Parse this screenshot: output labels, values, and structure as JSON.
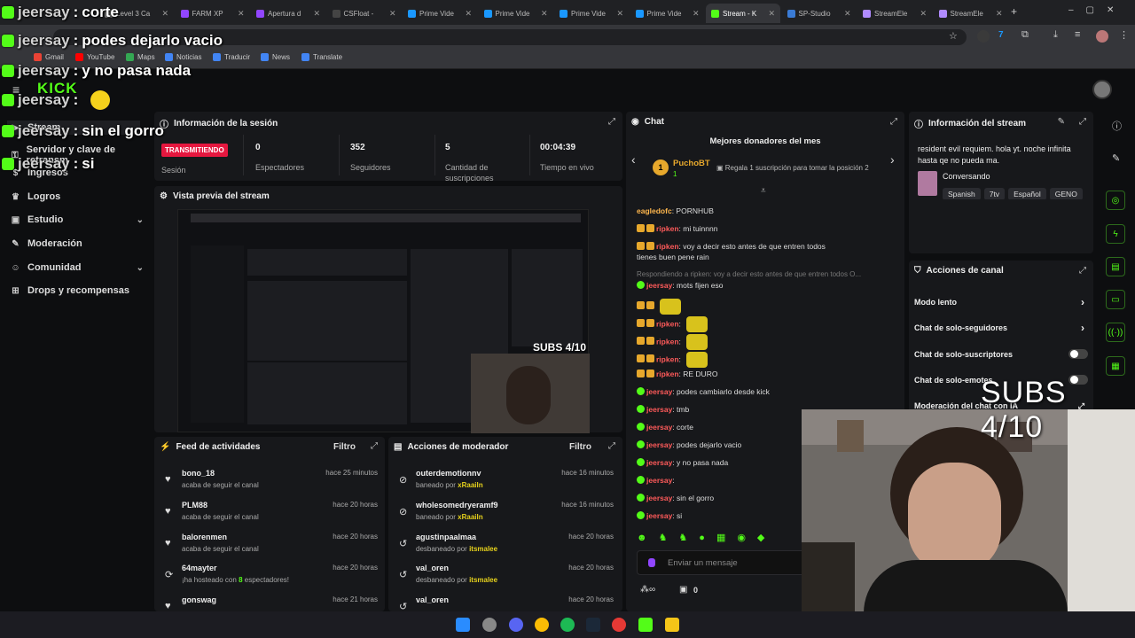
{
  "browser": {
    "tabs": [
      {
        "label": "Level 3 Ca",
        "color": "#7c7c7c"
      },
      {
        "label": "FARM XP",
        "color": "#9146ff"
      },
      {
        "label": "Apertura d",
        "color": "#9146ff"
      },
      {
        "label": "CSFloat -",
        "color": "#444"
      },
      {
        "label": "Prime Vide",
        "color": "#1a98ff"
      },
      {
        "label": "Prime Vide",
        "color": "#1a98ff"
      },
      {
        "label": "Prime Vide",
        "color": "#1a98ff"
      },
      {
        "label": "Prime Vide",
        "color": "#1a98ff"
      },
      {
        "label": "Stream - K",
        "color": "#53fc18"
      },
      {
        "label": "SP-Studio",
        "color": "#3a7bd5"
      },
      {
        "label": "StreamEle",
        "color": "#b08bff"
      },
      {
        "label": "StreamEle",
        "color": "#b08bff"
      }
    ],
    "bookmarks": [
      "Gmail",
      "YouTube",
      "Maps",
      "Noticias",
      "Traducir",
      "News",
      "Translate"
    ]
  },
  "overlay_chat": [
    {
      "user": "jeersay",
      "text": "corte"
    },
    {
      "user": "jeersay",
      "text": "podes dejarlo vacio"
    },
    {
      "user": "jeersay",
      "text": "y no pasa nada"
    },
    {
      "user": "jeersay",
      "text": ""
    },
    {
      "user": "jeersay",
      "text": "sin el gorro"
    },
    {
      "user": "jeersay",
      "text": "si"
    }
  ],
  "sidebar": {
    "logo": "KICK",
    "items": [
      {
        "label": "Stream",
        "icon": "stream-icon",
        "chevron": false
      },
      {
        "label": "Servidor y clave de retransm",
        "icon": "key-icon",
        "chevron": false
      },
      {
        "label": "Ingresos",
        "icon": "money-icon",
        "chevron": false
      },
      {
        "label": "Logros",
        "icon": "trophy-icon",
        "chevron": false
      },
      {
        "label": "Estudio",
        "icon": "studio-icon",
        "chevron": true
      },
      {
        "label": "Moderación",
        "icon": "wrench-icon",
        "chevron": false
      },
      {
        "label": "Comunidad",
        "icon": "community-icon",
        "chevron": true
      },
      {
        "label": "Drops y recompensas",
        "icon": "drops-icon",
        "chevron": false
      }
    ]
  },
  "session": {
    "title": "Información de la sesión",
    "status": "TRANSMITIENDO",
    "session_label": "Sesión",
    "stats": [
      {
        "value": "0",
        "label": "Espectadores"
      },
      {
        "value": "352",
        "label": "Seguidores"
      },
      {
        "value": "5",
        "label": "Cantidad de suscripciones"
      },
      {
        "value": "00:04:39",
        "label": "Tiempo en vivo"
      }
    ]
  },
  "preview": {
    "title": "Vista previa del stream",
    "subs_text": "SUBS 4/10"
  },
  "feed": {
    "title": "Feed de actividades",
    "filter": "Filtro",
    "items": [
      {
        "name": "bono_18",
        "desc": "acaba de seguir el canal",
        "time": "hace 25 minutos",
        "icon": "heart"
      },
      {
        "name": "PLM88",
        "desc": "acaba de seguir el canal",
        "time": "hace 20 horas",
        "icon": "heart"
      },
      {
        "name": "balorenmen",
        "desc": "acaba de seguir el canal",
        "time": "hace 20 horas",
        "icon": "heart"
      },
      {
        "name": "64mayter",
        "desc_pre": "¡ha hosteado con",
        "desc_hl": "8",
        "desc_post": "espectadores!",
        "time": "hace 20 horas",
        "icon": "host"
      },
      {
        "name": "gonswag",
        "desc": "",
        "time": "hace 21 horas",
        "icon": "heart"
      }
    ]
  },
  "mod": {
    "title": "Acciones de moderador",
    "filter": "Filtro",
    "items": [
      {
        "name": "outerdemotionnv",
        "pre": "baneado por",
        "by": "xRaailn",
        "time": "hace 16 minutos",
        "icon": "ban"
      },
      {
        "name": "wholesomedryeramf9",
        "pre": "baneado por",
        "by": "xRaailn",
        "time": "hace 16 minutos",
        "icon": "ban"
      },
      {
        "name": "agustinpaalmaa",
        "pre": "desbaneado por",
        "by": "itsmalee",
        "time": "hace 20 horas",
        "icon": "unban"
      },
      {
        "name": "val_oren",
        "pre": "desbaneado por",
        "by": "itsmalee",
        "time": "hace 20 horas",
        "icon": "unban"
      },
      {
        "name": "val_oren",
        "pre": "",
        "by": "",
        "time": "hace 20 horas",
        "icon": "unban"
      }
    ]
  },
  "chat": {
    "title": "Chat",
    "donors_title": "Mejores donadores del mes",
    "donor_name": "PuchoBT",
    "donor_count": "1",
    "donor_rank": "1",
    "donor_cta": "Regala 1 suscripción para tomar la posición 2",
    "messages": [
      {
        "user": "eagledofc",
        "text": "PORNHUB",
        "color": "green",
        "badges": 0,
        "sticker": false
      },
      {
        "user": "ripken",
        "text": "mi tuinnnn",
        "color": "red",
        "badges": 2,
        "sticker": false
      },
      {
        "user": "ripken",
        "text": "voy a decir esto antes de que entren todos",
        "color": "red",
        "badges": 2,
        "sticker": false
      },
      {
        "user": "",
        "text": "tienes buen pene rain",
        "color": "red",
        "badges": 0,
        "sticker": false
      },
      {
        "user": "",
        "text": "Respondiendo a ripken: voy a decir esto antes de que entren todos O...",
        "color": "reply",
        "badges": 0,
        "sticker": false
      },
      {
        "user": "jeersay",
        "text": "mots fijen eso",
        "color": "red",
        "badges": 1,
        "sticker": false
      },
      {
        "user": "",
        "text": "",
        "color": "red",
        "badges": 2,
        "sticker": true
      },
      {
        "user": "ripken",
        "text": "",
        "color": "red",
        "badges": 2,
        "sticker": true
      },
      {
        "user": "ripken",
        "text": "",
        "color": "red",
        "badges": 2,
        "sticker": true
      },
      {
        "user": "ripken",
        "text": "",
        "color": "red",
        "badges": 2,
        "sticker": true
      },
      {
        "user": "ripken",
        "text": "RE DURO",
        "color": "red",
        "badges": 2,
        "sticker": false
      },
      {
        "user": "jeersay",
        "text": "podes cambiarlo desde kick",
        "color": "red",
        "badges": 1,
        "sticker": false
      },
      {
        "user": "jeersay",
        "text": "tmb",
        "color": "red",
        "badges": 1,
        "sticker": false
      },
      {
        "user": "jeersay",
        "text": "corte",
        "color": "red",
        "badges": 1,
        "sticker": false
      },
      {
        "user": "jeersay",
        "text": "podes dejarlo vacio",
        "color": "red",
        "badges": 1,
        "sticker": false
      },
      {
        "user": "jeersay",
        "text": "y no pasa nada",
        "color": "red",
        "badges": 1,
        "sticker": false
      },
      {
        "user": "jeersay",
        "text": "",
        "color": "red",
        "badges": 1,
        "sticker": false
      },
      {
        "user": "jeersay",
        "text": "sin el gorro",
        "color": "red",
        "badges": 1,
        "sticker": false
      },
      {
        "user": "jeersay",
        "text": "si",
        "color": "red",
        "badges": 1,
        "sticker": false
      }
    ],
    "input_placeholder": "Enviar un mensaje",
    "bottom_count": "0"
  },
  "stream_info": {
    "title": "Información del stream",
    "stream_title": "resident evil requiem. hola yt. noche infinita hasta qe no pueda ma.",
    "category": "Conversando",
    "tags": [
      "Spanish",
      "7tv",
      "Español",
      "GENO"
    ]
  },
  "channel_actions": {
    "title": "Acciones de canal",
    "items": [
      {
        "label": "Modo lento",
        "control": "chevron"
      },
      {
        "label": "Chat de solo-seguidores",
        "control": "chevron"
      },
      {
        "label": "Chat de solo-suscriptores",
        "control": "toggle"
      },
      {
        "label": "Chat de solo-emotes",
        "control": "toggle"
      },
      {
        "label": "Moderación del chat con IA",
        "control": "expand"
      }
    ]
  },
  "subs_overlay": "SUBS 4/10",
  "colors": {
    "kick_green": "#53fc18",
    "live_red": "#e5173f",
    "panel": "#17181b",
    "bg": "#0d0e10"
  }
}
